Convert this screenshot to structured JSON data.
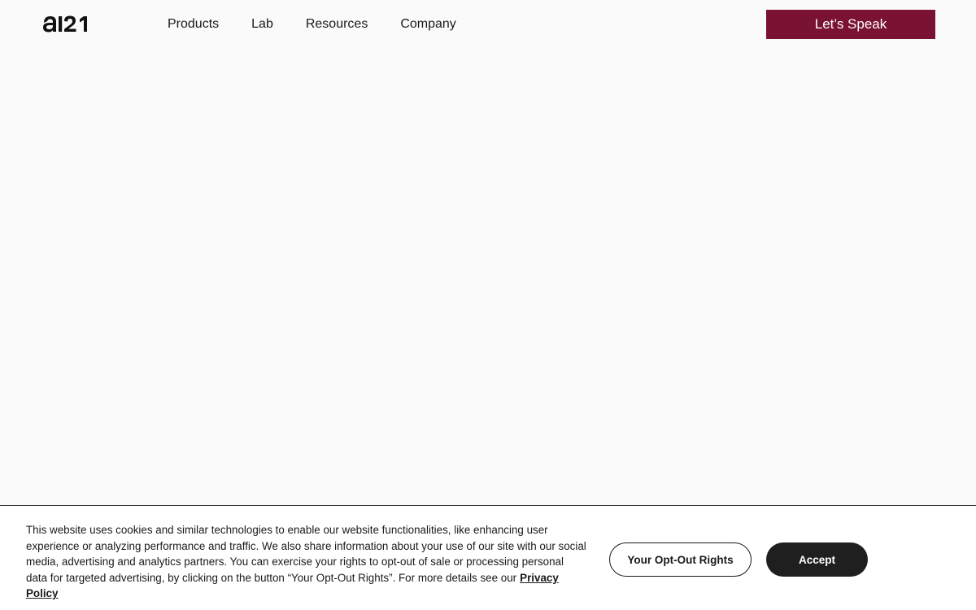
{
  "brand": {
    "logo_text": "ai21",
    "accent_color": "#7a1233"
  },
  "nav": {
    "items": [
      {
        "label": "Products"
      },
      {
        "label": "Lab"
      },
      {
        "label": "Resources"
      },
      {
        "label": "Company"
      }
    ],
    "cta_label": "Let’s Speak"
  },
  "cookie_banner": {
    "text": "This website uses cookies and similar technologies to enable our website functionalities, like enhancing user experience or analyzing performance and traffic. We also share information about your use of our site with our social media, advertising and analytics partners. You can exercise your rights to opt-out of sale or processing personal data for targeted advertising, by clicking on the button “Your Opt-Out Rights”. For more details see our",
    "privacy_link_label": "Privacy Policy",
    "optout_button_label": "Your Opt-Out Rights",
    "accept_button_label": "Accept"
  }
}
